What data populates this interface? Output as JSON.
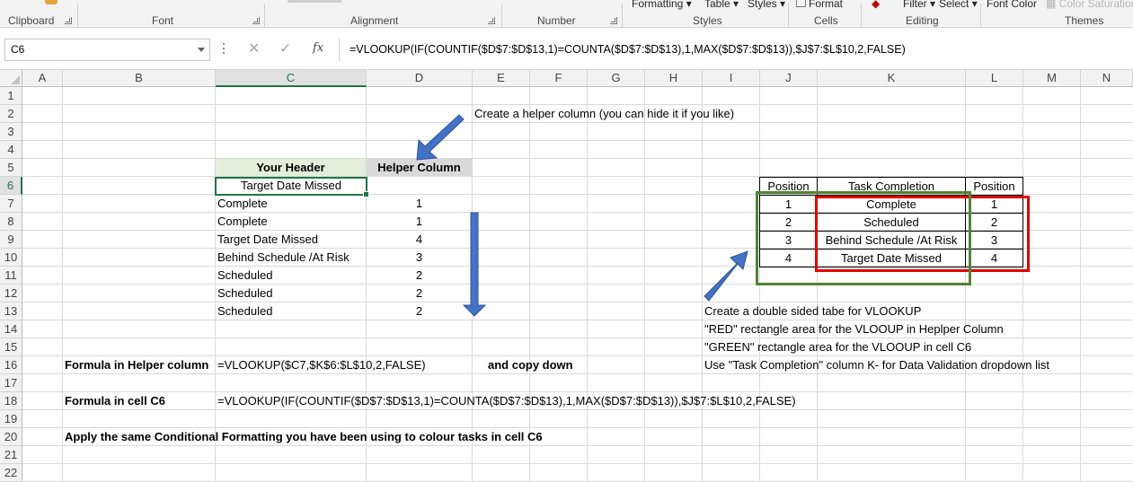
{
  "ribbon": {
    "top_items": [
      {
        "id": "formatting",
        "label": "Formatting"
      },
      {
        "id": "table",
        "label": "Table"
      },
      {
        "id": "styles",
        "label": "Styles"
      },
      {
        "id": "format",
        "label": "Format"
      },
      {
        "id": "filter",
        "label": "Filter"
      },
      {
        "id": "select",
        "label": "Select"
      },
      {
        "id": "font-color",
        "label": "Font Color"
      },
      {
        "id": "color-saturation",
        "label": "Color Saturation"
      }
    ],
    "groups": {
      "clipboard": "Clipboard",
      "font": "Font",
      "alignment": "Alignment",
      "number": "Number",
      "styles": "Styles",
      "cells": "Cells",
      "editing": "Editing",
      "themes": "Themes"
    }
  },
  "formula_bar": {
    "name_box": "C6",
    "cancel_icon": "✕",
    "enter_icon": "✓",
    "fx_label": "fx",
    "formula": "=VLOOKUP(IF(COUNTIF($D$7:$D$13,1)=COUNTA($D$7:$D$13),1,MAX($D$7:$D$13)),$J$7:$L$10,2,FALSE)"
  },
  "grid": {
    "selected_column": "C",
    "selected_row": "6",
    "columns": [
      "A",
      "B",
      "C",
      "D",
      "E",
      "F",
      "G",
      "H",
      "I",
      "J",
      "K",
      "L",
      "M",
      "N"
    ],
    "rows": [
      "1",
      "2",
      "3",
      "4",
      "5",
      "6",
      "7",
      "8",
      "9",
      "10",
      "11",
      "12",
      "13",
      "14",
      "15",
      "16",
      "17",
      "18",
      "19",
      "20",
      "21",
      "22"
    ]
  },
  "sheet": {
    "helper_note": "Create a helper column (you can hide it if you like)",
    "header_c5": "Your Header",
    "header_d5": "Helper Column",
    "c6_value": "Target Date Missed",
    "task_rows": [
      {
        "status": "Complete",
        "helper": "1"
      },
      {
        "status": "Complete",
        "helper": "1"
      },
      {
        "status": "Target Date Missed",
        "helper": "4"
      },
      {
        "status": "Behind Schedule /At Risk",
        "helper": "3"
      },
      {
        "status": "Scheduled",
        "helper": "2"
      },
      {
        "status": "Scheduled",
        "helper": "2"
      },
      {
        "status": "Scheduled",
        "helper": "2"
      }
    ],
    "lookup_headers": {
      "position_left": "Position",
      "task_completion": "Task Completion",
      "position_right": "Position"
    },
    "lookup_rows": [
      {
        "pos": "1",
        "task": "Complete",
        "pos2": "1"
      },
      {
        "pos": "2",
        "task": "Scheduled",
        "pos2": "2"
      },
      {
        "pos": "3",
        "task": "Behind Schedule /At Risk",
        "pos2": "3"
      },
      {
        "pos": "4",
        "task": "Target Date Missed",
        "pos2": "4"
      }
    ],
    "notes": [
      "Create a double sided tabe for VLOOKUP",
      "\"RED\" rectangle area for the VLOOUP in Heplper Column",
      "\"GREEN\" rectangle area for the VLOOUP in cell C6",
      "Use \"Task Completion\" column K- for Data Validation dropdown list"
    ],
    "formula_helper_label": "Formula in Helper column",
    "formula_helper": "=VLOOKUP($C7,$K$6:$L$10,2,FALSE)",
    "copy_down": "and copy down",
    "formula_c6_label": "Formula in cell C6",
    "formula_c6": "=VLOOKUP(IF(COUNTIF($D$7:$D$13,1)=COUNTA($D$7:$D$13),1,MAX($D$7:$D$13)),$J$7:$L$10,2,FALSE)",
    "conditional_note": "Apply the same Conditional Formatting you have been using to colour tasks in cell C6"
  },
  "colors": {
    "accent_green": "#217346",
    "arrow_blue": "#4472c4",
    "rect_red": "#e00000",
    "rect_green": "#548235",
    "header_green_fill": "#e2efda",
    "header_gray_fill": "#d9d9d9"
  }
}
